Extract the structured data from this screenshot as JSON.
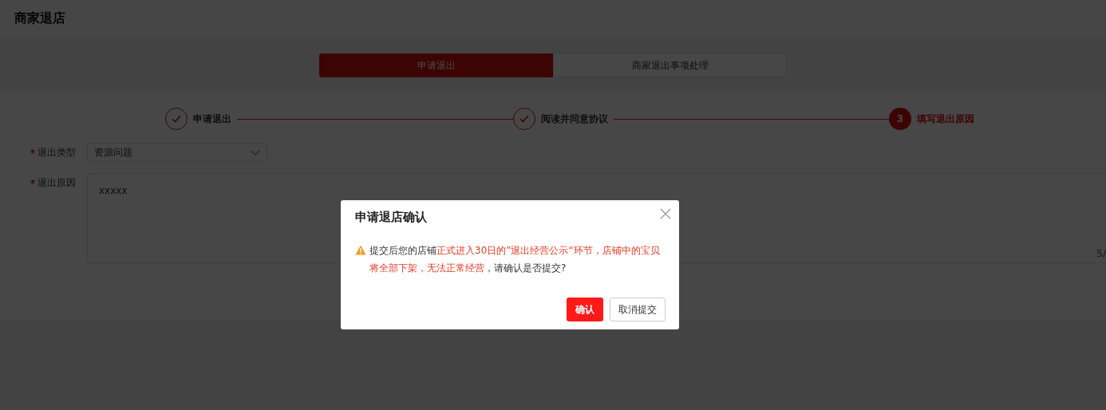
{
  "page_title": "商家退店",
  "tabs": [
    {
      "label": "申请退出",
      "selected": true
    },
    {
      "label": "商家退出事项处理",
      "selected": false
    }
  ],
  "steps": [
    {
      "label": "申请退出",
      "kind": "done"
    },
    {
      "label": "阅读并同意协议",
      "kind": "done"
    },
    {
      "label": "填写退出原因",
      "kind": "current",
      "number": "3"
    }
  ],
  "form": {
    "exit_type": {
      "label": "退出类型",
      "required": true,
      "value": "资源问题"
    },
    "exit_reason": {
      "label": "退出原因",
      "required": true,
      "value": "xxxxx",
      "counter": "5/"
    }
  },
  "dialog": {
    "title": "申请退店确认",
    "message": [
      {
        "text": "提交后您的店铺",
        "emphasis": false
      },
      {
        "text": "正式进入30日的”退出经营公示“环节，店铺中的宝贝将全部下架，无法正常经营",
        "emphasis": true
      },
      {
        "text": "，请确认是否提交?",
        "emphasis": false
      }
    ],
    "buttons": [
      {
        "label": "确认",
        "kind": "primary"
      },
      {
        "label": "取消提交",
        "kind": "secondary"
      }
    ]
  }
}
